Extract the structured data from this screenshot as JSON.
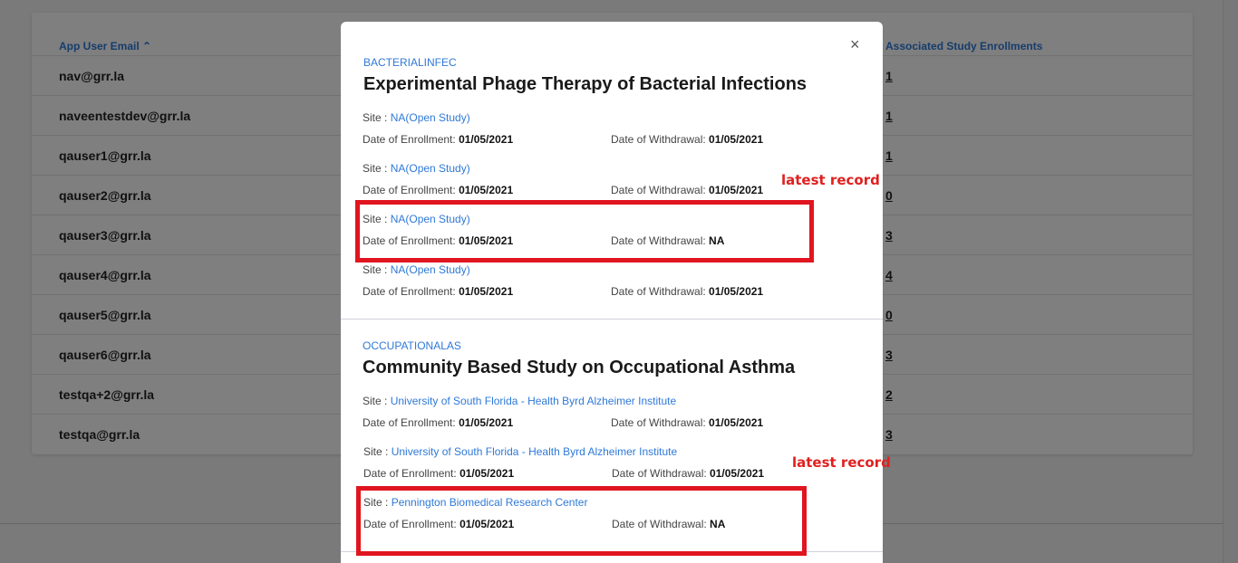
{
  "table": {
    "header_email": "App User Email",
    "sort_icon": "sort-asc-icon",
    "header_enrollments": "Associated Study Enrollments",
    "rows": [
      {
        "email": "nav@grr.la",
        "count": "1"
      },
      {
        "email": "naveentestdev@grr.la",
        "count": "1"
      },
      {
        "email": "qauser1@grr.la",
        "count": "1"
      },
      {
        "email": "qauser2@grr.la",
        "count": "0"
      },
      {
        "email": "qauser3@grr.la",
        "count": "3"
      },
      {
        "email": "qauser4@grr.la",
        "count": "4"
      },
      {
        "email": "qauser5@grr.la",
        "count": "0"
      },
      {
        "email": "qauser6@grr.la",
        "count": "3"
      },
      {
        "email": "testqa+2@grr.la",
        "count": "2"
      },
      {
        "email": "testqa@grr.la",
        "count": "3"
      }
    ]
  },
  "modal": {
    "close_symbol": "×",
    "labels": {
      "site": "Site : ",
      "enroll": "Date of Enrollment: ",
      "withdraw": "Date of Withdrawal: "
    },
    "studies": [
      {
        "code": "BACTERIALINFEC",
        "title": "Experimental Phage Therapy of Bacterial Infections",
        "records": [
          {
            "site": "NA(Open Study)",
            "enrolled": "01/05/2021",
            "withdrawn": "01/05/2021"
          },
          {
            "site": "NA(Open Study)",
            "enrolled": "01/05/2021",
            "withdrawn": "01/05/2021"
          },
          {
            "site": "NA(Open Study)",
            "enrolled": "01/05/2021",
            "withdrawn": "NA"
          },
          {
            "site": "NA(Open Study)",
            "enrolled": "01/05/2021",
            "withdrawn": "01/05/2021"
          }
        ]
      },
      {
        "code": "OCCUPATIONALAS",
        "title": "Community Based Study on Occupational Asthma",
        "records": [
          {
            "site": "University of South Florida - Health Byrd Alzheimer Institute",
            "enrolled": "01/05/2021",
            "withdrawn": "01/05/2021"
          },
          {
            "site": "University of South Florida - Health Byrd Alzheimer Institute",
            "enrolled": "01/05/2021",
            "withdrawn": "01/05/2021"
          },
          {
            "site": "Pennington Biomedical Research Center",
            "enrolled": "01/05/2021",
            "withdrawn": "NA"
          }
        ]
      }
    ]
  },
  "annotations": {
    "latest_1": "latest record",
    "latest_2": "latest record",
    "color": "#e0151f"
  }
}
